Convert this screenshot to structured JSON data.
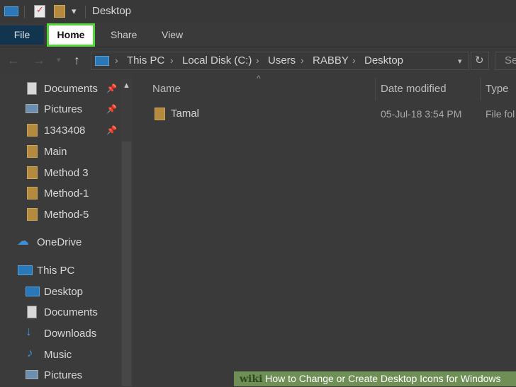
{
  "title_bar": {
    "title": "Desktop",
    "qat_dropdown": "▾"
  },
  "ribbon": {
    "tabs": [
      "File",
      "Home",
      "Share",
      "View"
    ]
  },
  "address_bar": {
    "breadcrumbs": [
      "This PC",
      "Local Disk (C:)",
      "Users",
      "RABBY",
      "Desktop"
    ],
    "separator": "›",
    "search_placeholder": "Se"
  },
  "nav_pane": {
    "quick_access": [
      {
        "label": "Documents",
        "icon": "documents-icon",
        "pinned": true
      },
      {
        "label": "Pictures",
        "icon": "pictures-icon",
        "pinned": true
      },
      {
        "label": "1343408",
        "icon": "folder-icon",
        "pinned": true
      },
      {
        "label": "Main",
        "icon": "folder-icon",
        "pinned": false
      },
      {
        "label": "Method 3",
        "icon": "folder-icon",
        "pinned": false
      },
      {
        "label": "Method-1",
        "icon": "folder-icon",
        "pinned": false
      },
      {
        "label": "Method-5",
        "icon": "folder-icon",
        "pinned": false
      }
    ],
    "onedrive": "OneDrive",
    "this_pc": "This PC",
    "this_pc_items": [
      {
        "label": "Desktop",
        "icon": "desktop-icon"
      },
      {
        "label": "Documents",
        "icon": "documents-icon"
      },
      {
        "label": "Downloads",
        "icon": "downloads-icon"
      },
      {
        "label": "Music",
        "icon": "music-icon"
      },
      {
        "label": "Pictures",
        "icon": "pictures-icon"
      }
    ]
  },
  "file_list": {
    "columns": [
      "Name",
      "Date modified",
      "Type"
    ],
    "rows": [
      {
        "name": "Tamal",
        "date": "05-Jul-18 3:54 PM",
        "type": "File fol"
      }
    ]
  },
  "watermark": {
    "logo": "wiki",
    "text": "How to Change or Create Desktop Icons for Windows"
  },
  "colors": {
    "highlight": "#52d63a",
    "file_tab": "#11354f",
    "folder": "#b48b3e",
    "banner": "#6f8f57"
  }
}
